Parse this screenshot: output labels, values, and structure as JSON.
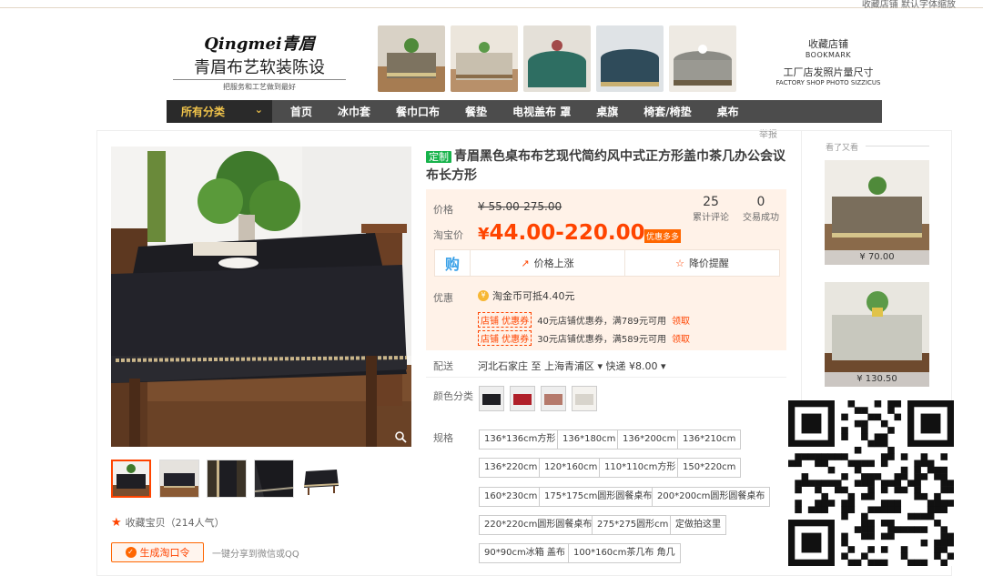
{
  "topbar": {
    "right_text": "收藏店铺    默认字体缩放"
  },
  "header": {
    "logo_en": "Qingmei青眉",
    "logo_cn": "青眉布艺软装陈设",
    "logo_sub": "把服务和工艺做到最好",
    "right": {
      "collect": "收藏店铺",
      "bookmark": "BOOKMARK",
      "factory": "工厂店发照片量尺寸",
      "factory_en": "FACTORY SHOP PHOTO SIZZICUS"
    }
  },
  "nav": {
    "all": "所有分类",
    "items": [
      "首页",
      "冰巾套",
      "餐巾口布",
      "餐垫",
      "电视盖布 罩",
      "桌旗",
      "椅套/椅垫",
      "桌布"
    ]
  },
  "report": "举报",
  "product": {
    "tag": "定制",
    "title": "青眉黑色桌布布艺现代简约风中式正方形盖巾茶几办公会议布长方形",
    "price_label": "价格",
    "original_price": "¥ 55.00-275.00",
    "taobao_label": "淘宝价",
    "taobao_currency": "¥",
    "taobao_price": "44.00-220.00",
    "discount_badge": "优惠多多",
    "reviews_count": "25",
    "reviews_label": "累计评论",
    "deals_count": "0",
    "deals_label": "交易成功",
    "alert_gou": "购",
    "price_up": "价格上涨",
    "price_drop": "降价提醒",
    "discount_label": "优惠",
    "coin_text": "淘金币可抵4.40元",
    "coupons": [
      {
        "tag": "店铺 优惠券",
        "text": "40元店铺优惠券，满789元可用",
        "get": "领取"
      },
      {
        "tag": "店铺 优惠券",
        "text": "30元店铺优惠券，满589元可用",
        "get": "领取"
      }
    ],
    "ship_label": "配送",
    "ship_text": "河北石家庄 至  上海青浦区 ▾   快递 ¥8.00 ▾",
    "color_label": "颜色分类",
    "spec_label": "规格",
    "specs": [
      "136*136cm方形",
      "136*180cm",
      "136*200cm",
      "136*210cm",
      "136*220cm",
      "120*160cm",
      "110*110cm方形",
      "150*220cm",
      "160*230cm",
      "175*175cm圆形圆餐桌布",
      "200*200cm圆形圆餐桌布",
      "220*220cm圆形圆餐桌布",
      "275*275圆形cm",
      "定做拍这里",
      "90*90cm冰箱 盖布",
      "100*160cm茶几布 角几"
    ]
  },
  "gallery": {
    "fav_text": "收藏宝贝（214人气）",
    "taoq_label": "生成淘口令",
    "share_text": "一键分享到微信或QQ"
  },
  "side": {
    "header": "看了又看",
    "items": [
      {
        "price": "¥ 70.00"
      },
      {
        "price": "¥ 130.50"
      }
    ]
  },
  "colors": {
    "accent": "#ff4400",
    "nav_bg": "#4c4c4c",
    "price_bg": "#fff2e8",
    "tag_green": "#17b34b"
  }
}
